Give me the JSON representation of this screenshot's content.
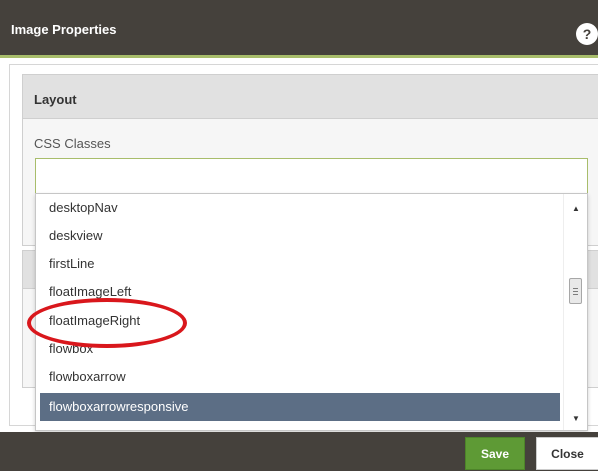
{
  "dialog": {
    "title": "Image Properties",
    "help_icon_glyph": "?"
  },
  "layout_section": {
    "title": "Layout",
    "css_classes_label": "CSS Classes",
    "css_classes_value": ""
  },
  "dropdown": {
    "options": [
      "desktopNav",
      "deskview",
      "firstLine",
      "floatImageLeft",
      "floatImageRight",
      "flowbox",
      "flowboxarrow",
      "flowboxarrowresponsive"
    ],
    "selected": "flowboxarrowresponsive",
    "highlighted_annotation": "floatImageRight"
  },
  "footer": {
    "save_label": "Save",
    "close_label": "Close"
  },
  "colors": {
    "header_bg": "#45413c",
    "accent_green": "#a8bd6b",
    "save_green": "#5e9a35",
    "selection_blue": "#5c6e85",
    "annotation_red": "#d9171c"
  }
}
